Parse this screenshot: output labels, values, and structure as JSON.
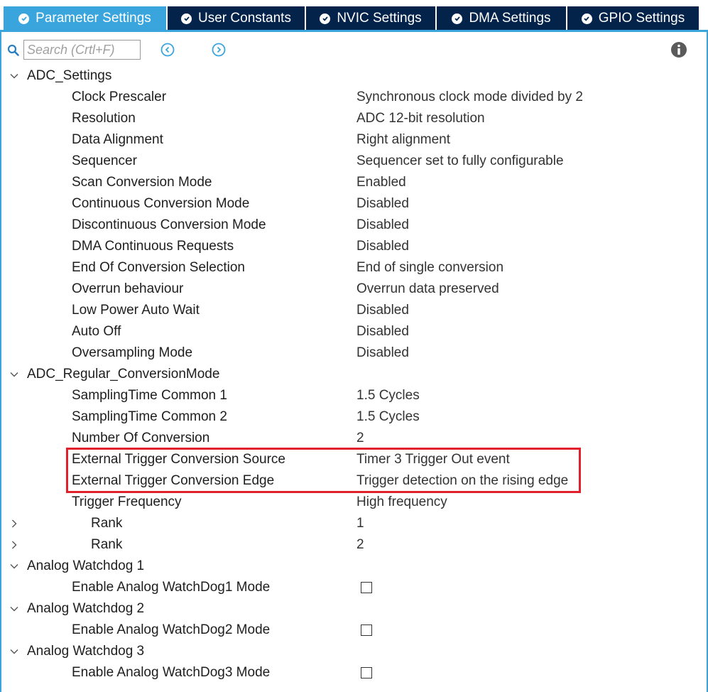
{
  "tabs": [
    {
      "label": "Parameter Settings",
      "active": true,
      "icon": "check-circle-icon"
    },
    {
      "label": "User Constants",
      "active": false,
      "icon": "check-circle-icon"
    },
    {
      "label": "NVIC Settings",
      "active": false,
      "icon": "check-circle-icon"
    },
    {
      "label": "DMA Settings",
      "active": false,
      "icon": "check-circle-icon"
    },
    {
      "label": "GPIO Settings",
      "active": false,
      "icon": "check-circle-icon"
    }
  ],
  "toolbar": {
    "search_placeholder": "Search (Crtl+F)",
    "search_value": "",
    "icons": [
      "search-icon",
      "previous-icon",
      "next-icon",
      "info-icon"
    ]
  },
  "colors": {
    "tab_active": "#39a5dc",
    "tab_inactive": "#03234b",
    "highlight_border": "#e0202a"
  },
  "tree": [
    {
      "type": "group",
      "label": "ADC_Settings",
      "expanded": true
    },
    {
      "type": "param",
      "label": "Clock Prescaler",
      "value": "Synchronous clock mode divided by 2"
    },
    {
      "type": "param",
      "label": "Resolution",
      "value": "ADC 12-bit resolution"
    },
    {
      "type": "param",
      "label": "Data Alignment",
      "value": "Right alignment"
    },
    {
      "type": "param",
      "label": "Sequencer",
      "value": "Sequencer set to fully configurable"
    },
    {
      "type": "param",
      "label": "Scan Conversion Mode",
      "value": "Enabled"
    },
    {
      "type": "param",
      "label": "Continuous Conversion Mode",
      "value": "Disabled"
    },
    {
      "type": "param",
      "label": "Discontinuous Conversion Mode",
      "value": "Disabled"
    },
    {
      "type": "param",
      "label": "DMA Continuous Requests",
      "value": "Disabled"
    },
    {
      "type": "param",
      "label": "End Of Conversion Selection",
      "value": "End of single conversion"
    },
    {
      "type": "param",
      "label": "Overrun behaviour",
      "value": "Overrun data preserved"
    },
    {
      "type": "param",
      "label": "Low Power Auto Wait",
      "value": "Disabled"
    },
    {
      "type": "param",
      "label": "Auto Off",
      "value": "Disabled"
    },
    {
      "type": "param",
      "label": "Oversampling Mode",
      "value": "Disabled"
    },
    {
      "type": "group",
      "label": "ADC_Regular_ConversionMode",
      "expanded": true
    },
    {
      "type": "param",
      "label": "SamplingTime Common 1",
      "value": "1.5 Cycles"
    },
    {
      "type": "param",
      "label": "SamplingTime Common 2",
      "value": "1.5 Cycles"
    },
    {
      "type": "param",
      "label": "Number Of Conversion",
      "value": "2"
    },
    {
      "type": "param",
      "label": "External Trigger Conversion Source",
      "value": "Timer 3 Trigger Out event",
      "highlighted": true
    },
    {
      "type": "param",
      "label": "External Trigger Conversion Edge",
      "value": "Trigger detection on the rising edge",
      "highlighted": true
    },
    {
      "type": "param",
      "label": "Trigger Frequency",
      "value": "High frequency"
    },
    {
      "type": "subgroup",
      "label": "Rank",
      "value": "1",
      "expanded": false
    },
    {
      "type": "subgroup",
      "label": "Rank",
      "value": "2",
      "expanded": false
    },
    {
      "type": "group",
      "label": "Analog Watchdog 1",
      "expanded": true
    },
    {
      "type": "checkbox",
      "label": "Enable Analog WatchDog1 Mode",
      "checked": false
    },
    {
      "type": "group",
      "label": "Analog Watchdog 2",
      "expanded": true
    },
    {
      "type": "checkbox",
      "label": "Enable Analog WatchDog2 Mode",
      "checked": false
    },
    {
      "type": "group",
      "label": "Analog Watchdog 3",
      "expanded": true
    },
    {
      "type": "checkbox",
      "label": "Enable Analog WatchDog3 Mode",
      "checked": false
    }
  ]
}
